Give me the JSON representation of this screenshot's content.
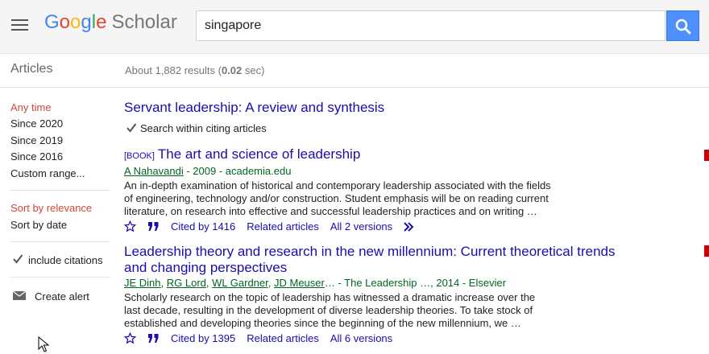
{
  "header": {
    "logo_google": [
      "G",
      "o",
      "o",
      "g",
      "l",
      "e"
    ],
    "logo_scholar": "Scholar",
    "search_value": "singapore"
  },
  "subbar": {
    "articles_label": "Articles",
    "results_prefix": "About 1,882 results (",
    "results_time": "0.02",
    "results_suffix": " sec)"
  },
  "sidebar": {
    "time_filters": [
      "Any time",
      "Since 2020",
      "Since 2019",
      "Since 2016",
      "Custom range..."
    ],
    "sort": [
      "Sort by relevance",
      "Sort by date"
    ],
    "include_citations": "include citations",
    "create_alert": "Create alert"
  },
  "results": [
    {
      "title": "Servant leadership: A review and synthesis",
      "citing_label": "Search within citing articles"
    },
    {
      "tag": "[BOOK]",
      "title": "The art and science of leadership",
      "authors": [
        "A Nahavandi"
      ],
      "source": " - 2009 - academia.edu",
      "snippet": [
        "An in-depth examination of historical and contemporary leadership associated with the fields",
        "of engineering, technology and/or construction. Student emphasis will be on reading current",
        "literature, on research into effective and successful leadership practices and on writing …"
      ],
      "cited_by": "Cited by 1416",
      "related": "Related articles",
      "versions": "All 2 versions"
    },
    {
      "title_lines": [
        "Leadership theory and research in the new millennium: Current theoretical trends",
        "and changing perspectives"
      ],
      "authors": [
        "JE Dinh",
        "RG Lord",
        "WL Gardner",
        "JD Meuser"
      ],
      "source": "… - The Leadership …, 2014 - Elsevier",
      "snippet": [
        "Scholarly research on the topic of leadership has witnessed a dramatic increase over the",
        "last decade, resulting in the development of diverse leadership theories. To take stock of",
        "established and developing theories since the beginning of the new millennium, we …"
      ],
      "cited_by": "Cited by 1395",
      "related": "Related articles",
      "versions": "All 6 versions"
    }
  ],
  "colors": {
    "link": "#1a0dab",
    "author": "#006621",
    "active": "#d14836",
    "search_button": "#4d90fe"
  }
}
